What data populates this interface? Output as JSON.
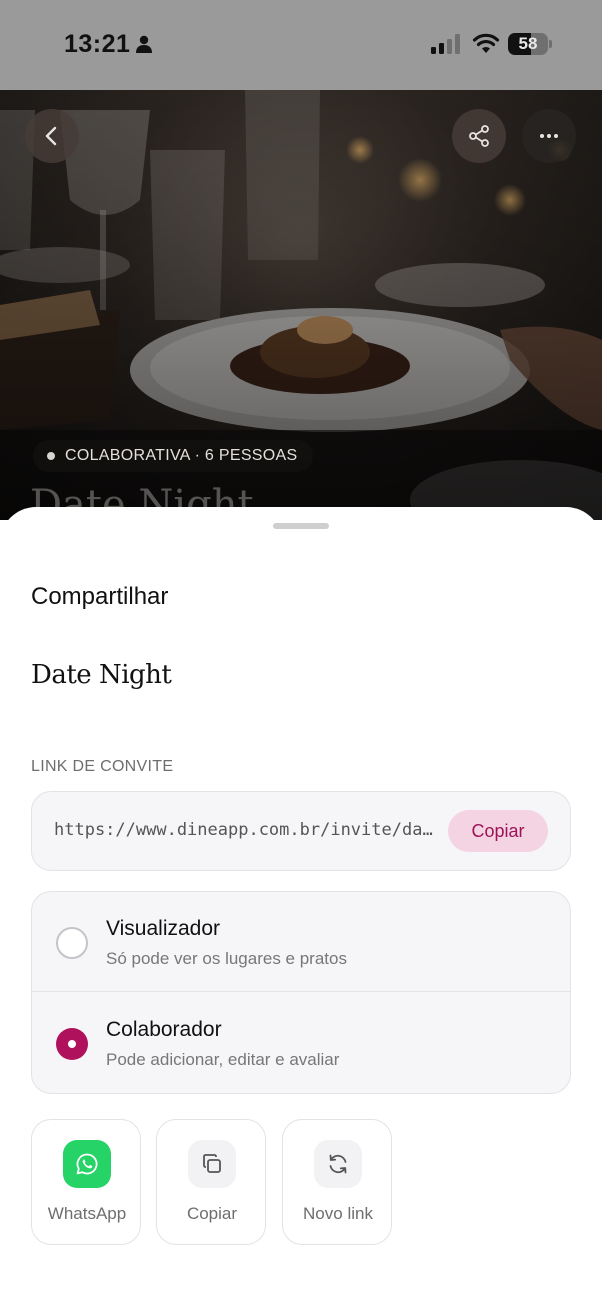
{
  "status_bar": {
    "time": "13:21",
    "battery": "58",
    "battery_level": 0.58
  },
  "hero": {
    "badge": "COLABORATIVA · 6 PESSOAS",
    "title_peek": "Date Night",
    "back_icon": "chevron-left-icon",
    "share_icon": "share-icon",
    "more_icon": "more-horizontal-icon"
  },
  "sheet": {
    "title": "Compartilhar",
    "list_name": "Date Night",
    "invite_label": "LINK DE CONVITE",
    "invite_url": "https://www.dineapp.com.br/invite/date-night",
    "copy_label": "Copiar",
    "roles": [
      {
        "title": "Visualizador",
        "description": "Só pode ver os lugares e pratos",
        "selected": false
      },
      {
        "title": "Colaborador",
        "description": "Pode adicionar, editar e avaliar",
        "selected": true
      }
    ],
    "actions": [
      {
        "label": "WhatsApp",
        "icon": "whatsapp-icon"
      },
      {
        "label": "Copiar",
        "icon": "copy-icon"
      },
      {
        "label": "Novo link",
        "icon": "refresh-icon"
      }
    ]
  },
  "colors": {
    "accent": "#b0115c",
    "accent_soft": "#f4d3e2",
    "whatsapp": "#25d366"
  }
}
